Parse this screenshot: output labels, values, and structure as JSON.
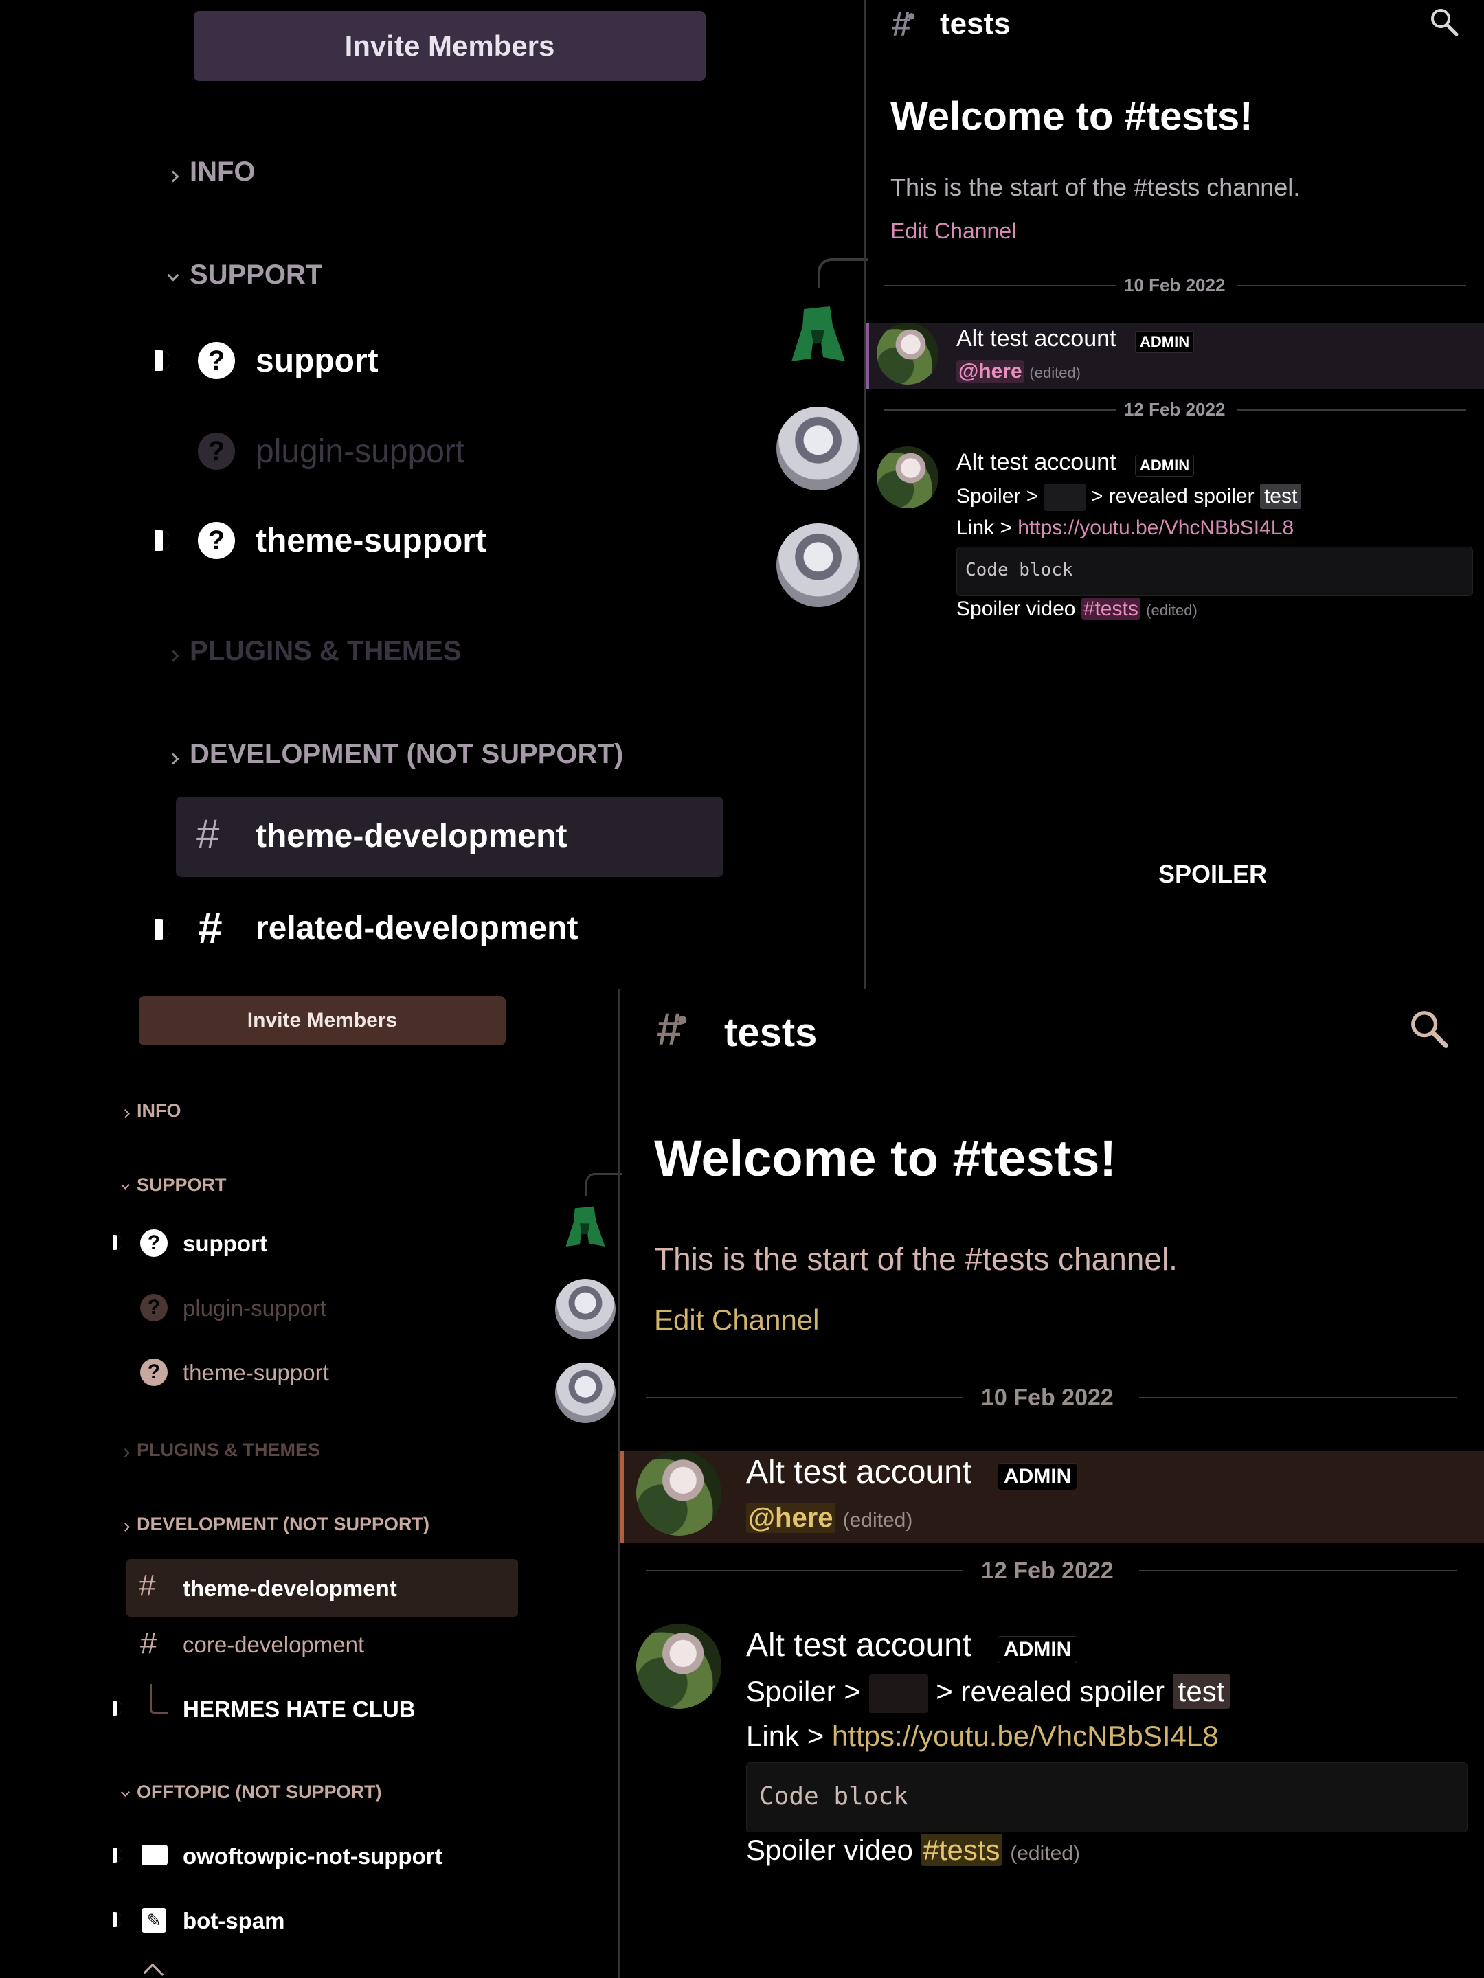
{
  "top": {
    "sidebar": {
      "invite_button": "Invite Members",
      "categories": {
        "info": "INFO",
        "support": "SUPPORT",
        "plugins": "PLUGINS & THEMES",
        "development": "DEVELOPMENT (NOT SUPPORT)"
      },
      "channels": {
        "support": "support",
        "plugin_support": "plugin-support",
        "theme_support": "theme-support",
        "theme_development": "theme-development",
        "related_development": "related-development"
      }
    },
    "chat": {
      "channel_name": "tests",
      "welcome_title": "Welcome to #tests!",
      "welcome_subtitle": "This is the start of the #tests channel.",
      "edit_channel": "Edit Channel",
      "date1": "10 Feb 2022",
      "date2": "12 Feb 2022",
      "msg1": {
        "author": "Alt test account",
        "badge": "ADMIN",
        "mention": "@here",
        "edited": "(edited)"
      },
      "msg2": {
        "author": "Alt test account",
        "badge": "ADMIN",
        "spoiler_prefix": "Spoiler >",
        "spoiler_suffix": "> revealed spoiler",
        "revealed": "test",
        "link_prefix": "Link >",
        "link": "https://youtu.be/VhcNBbSI4L8",
        "code": "Code block",
        "video_prefix": "Spoiler video",
        "channel_mention": "#tests",
        "edited": "(edited)"
      },
      "spoiler_overlay": "SPOILER"
    }
  },
  "bottom": {
    "sidebar": {
      "invite_button": "Invite Members",
      "categories": {
        "info": "INFO",
        "support": "SUPPORT",
        "plugins": "PLUGINS & THEMES",
        "development": "DEVELOPMENT (NOT SUPPORT)",
        "offtopic": "OFFTOPIC (NOT SUPPORT)"
      },
      "channels": {
        "support": "support",
        "plugin_support": "plugin-support",
        "theme_support": "theme-support",
        "theme_development": "theme-development",
        "core_development": "core-development",
        "hermes": "HERMES HATE CLUB",
        "owoftowpic": "owoftowpic-not-support",
        "bot_spam": "bot-spam"
      }
    },
    "chat": {
      "channel_name": "tests",
      "welcome_title": "Welcome to #tests!",
      "welcome_subtitle": "This is the start of the #tests channel.",
      "edit_channel": "Edit Channel",
      "date1": "10 Feb 2022",
      "date2": "12 Feb 2022",
      "msg1": {
        "author": "Alt test account",
        "badge": "ADMIN",
        "mention": "@here",
        "edited": "(edited)"
      },
      "msg2": {
        "author": "Alt test account",
        "badge": "ADMIN",
        "spoiler_prefix": "Spoiler >",
        "spoiler_suffix": "> revealed spoiler",
        "revealed": "test",
        "link_prefix": "Link >",
        "link": "https://youtu.be/VhcNBbSI4L8",
        "code": "Code block",
        "video_prefix": "Spoiler video",
        "channel_mention": "#tests",
        "edited": "(edited)"
      }
    }
  },
  "theme": {
    "top_accent": "#d98bb8",
    "top_button_bg": "#3b2f45",
    "top_selected_bg": "#252029",
    "bottom_accent": "#d2b46a",
    "bottom_button_bg": "#4a2e28",
    "bottom_selected_bg": "#2b1f1b",
    "bottom_highlight_bg": "#2a1a15"
  }
}
